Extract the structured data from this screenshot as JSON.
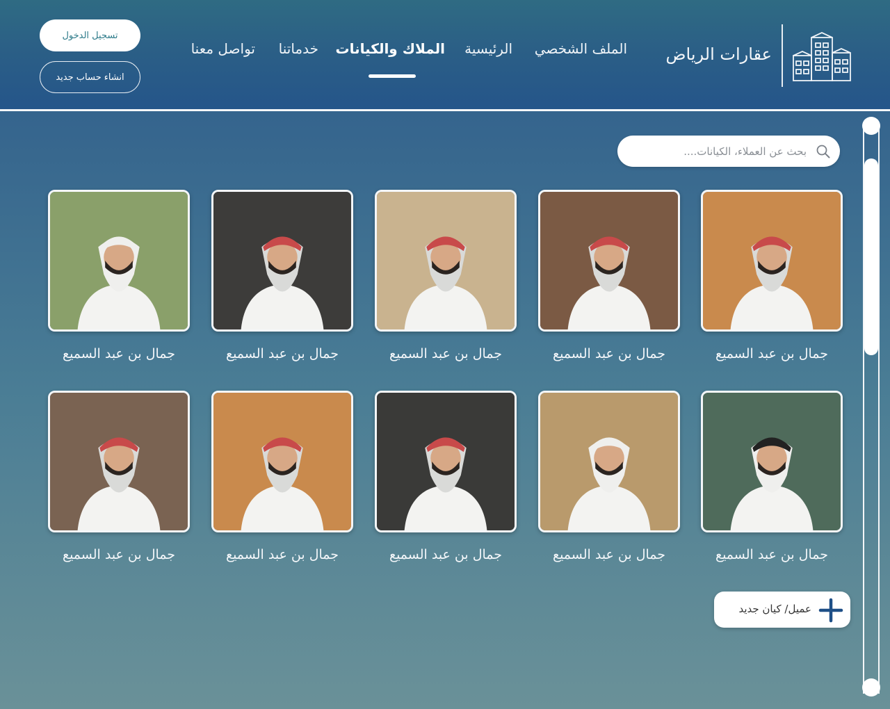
{
  "header": {
    "brand": "عقارات الرياض",
    "nav": [
      {
        "label": "الملف الشخصي"
      },
      {
        "label": "الرئيسية"
      },
      {
        "label": "الملاك والكيانات",
        "active": true
      },
      {
        "label": "خدماتنا"
      },
      {
        "label": "تواصل معنا"
      }
    ],
    "login_label": "تسجيل الدخول",
    "register_label": "انشاء حساب جديد"
  },
  "search": {
    "placeholder": "بحث عن العملاء، الكيانات....",
    "icon": "search-icon"
  },
  "clients": [
    {
      "name": "جمال بن عبد السميع",
      "bg": "#c98a4d"
    },
    {
      "name": "جمال بن عبد السميع",
      "bg": "#7b5a44"
    },
    {
      "name": "جمال بن عبد السميع",
      "bg": "#c9b38f"
    },
    {
      "name": "جمال بن عبد السميع",
      "bg": "#3d3c3a"
    },
    {
      "name": "جمال بن عبد السميع",
      "bg": "#8aa06a"
    },
    {
      "name": "جمال بن عبد السميع",
      "bg": "#4f6b5b"
    },
    {
      "name": "جمال بن عبد السميع",
      "bg": "#b99a6c"
    },
    {
      "name": "جمال بن عبد السميع",
      "bg": "#3a3a38"
    },
    {
      "name": "جمال بن عبد السميع",
      "bg": "#c98a4d"
    },
    {
      "name": "جمال بن عبد السميع",
      "bg": "#7a6352"
    }
  ],
  "add_button": {
    "label": "عميل/ كيان جديد",
    "icon": "plus-icon"
  },
  "colors": {
    "accent": "#25558a",
    "plus": "#1e4f87"
  }
}
